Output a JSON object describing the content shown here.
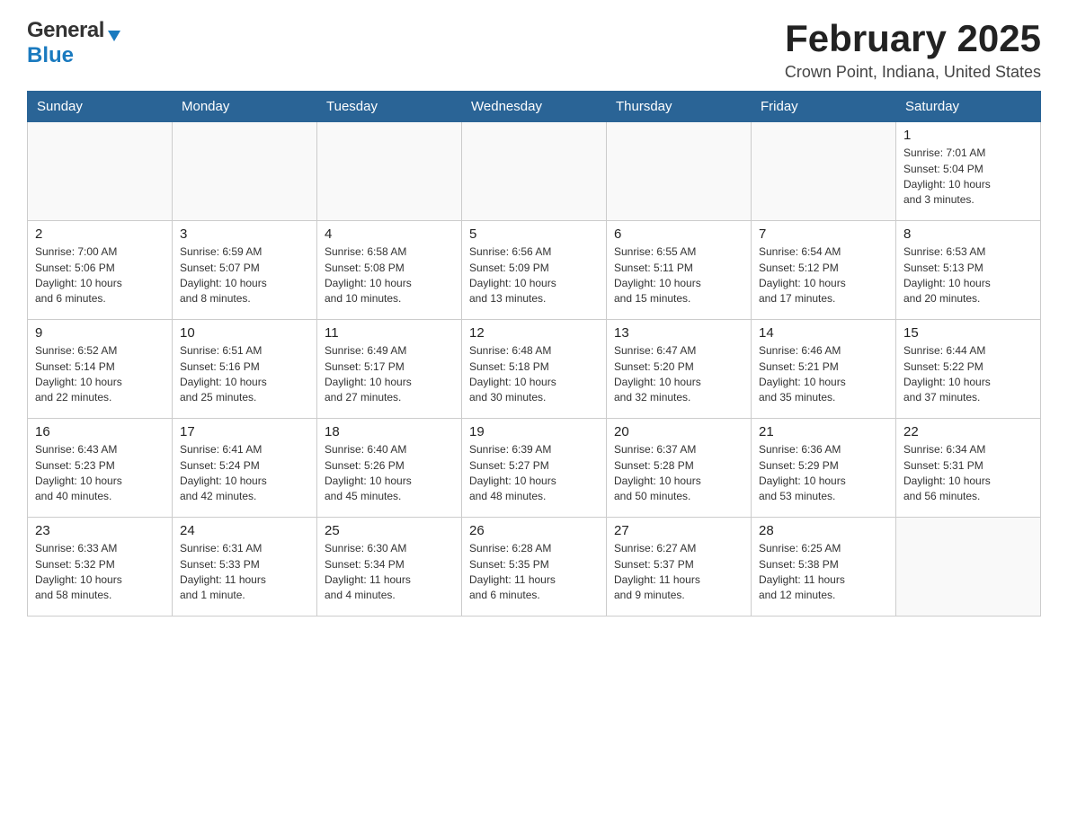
{
  "header": {
    "logo_general": "General",
    "logo_blue": "Blue",
    "month_title": "February 2025",
    "location": "Crown Point, Indiana, United States"
  },
  "days_of_week": [
    "Sunday",
    "Monday",
    "Tuesday",
    "Wednesday",
    "Thursday",
    "Friday",
    "Saturday"
  ],
  "weeks": [
    [
      {
        "day": "",
        "info": ""
      },
      {
        "day": "",
        "info": ""
      },
      {
        "day": "",
        "info": ""
      },
      {
        "day": "",
        "info": ""
      },
      {
        "day": "",
        "info": ""
      },
      {
        "day": "",
        "info": ""
      },
      {
        "day": "1",
        "info": "Sunrise: 7:01 AM\nSunset: 5:04 PM\nDaylight: 10 hours\nand 3 minutes."
      }
    ],
    [
      {
        "day": "2",
        "info": "Sunrise: 7:00 AM\nSunset: 5:06 PM\nDaylight: 10 hours\nand 6 minutes."
      },
      {
        "day": "3",
        "info": "Sunrise: 6:59 AM\nSunset: 5:07 PM\nDaylight: 10 hours\nand 8 minutes."
      },
      {
        "day": "4",
        "info": "Sunrise: 6:58 AM\nSunset: 5:08 PM\nDaylight: 10 hours\nand 10 minutes."
      },
      {
        "day": "5",
        "info": "Sunrise: 6:56 AM\nSunset: 5:09 PM\nDaylight: 10 hours\nand 13 minutes."
      },
      {
        "day": "6",
        "info": "Sunrise: 6:55 AM\nSunset: 5:11 PM\nDaylight: 10 hours\nand 15 minutes."
      },
      {
        "day": "7",
        "info": "Sunrise: 6:54 AM\nSunset: 5:12 PM\nDaylight: 10 hours\nand 17 minutes."
      },
      {
        "day": "8",
        "info": "Sunrise: 6:53 AM\nSunset: 5:13 PM\nDaylight: 10 hours\nand 20 minutes."
      }
    ],
    [
      {
        "day": "9",
        "info": "Sunrise: 6:52 AM\nSunset: 5:14 PM\nDaylight: 10 hours\nand 22 minutes."
      },
      {
        "day": "10",
        "info": "Sunrise: 6:51 AM\nSunset: 5:16 PM\nDaylight: 10 hours\nand 25 minutes."
      },
      {
        "day": "11",
        "info": "Sunrise: 6:49 AM\nSunset: 5:17 PM\nDaylight: 10 hours\nand 27 minutes."
      },
      {
        "day": "12",
        "info": "Sunrise: 6:48 AM\nSunset: 5:18 PM\nDaylight: 10 hours\nand 30 minutes."
      },
      {
        "day": "13",
        "info": "Sunrise: 6:47 AM\nSunset: 5:20 PM\nDaylight: 10 hours\nand 32 minutes."
      },
      {
        "day": "14",
        "info": "Sunrise: 6:46 AM\nSunset: 5:21 PM\nDaylight: 10 hours\nand 35 minutes."
      },
      {
        "day": "15",
        "info": "Sunrise: 6:44 AM\nSunset: 5:22 PM\nDaylight: 10 hours\nand 37 minutes."
      }
    ],
    [
      {
        "day": "16",
        "info": "Sunrise: 6:43 AM\nSunset: 5:23 PM\nDaylight: 10 hours\nand 40 minutes."
      },
      {
        "day": "17",
        "info": "Sunrise: 6:41 AM\nSunset: 5:24 PM\nDaylight: 10 hours\nand 42 minutes."
      },
      {
        "day": "18",
        "info": "Sunrise: 6:40 AM\nSunset: 5:26 PM\nDaylight: 10 hours\nand 45 minutes."
      },
      {
        "day": "19",
        "info": "Sunrise: 6:39 AM\nSunset: 5:27 PM\nDaylight: 10 hours\nand 48 minutes."
      },
      {
        "day": "20",
        "info": "Sunrise: 6:37 AM\nSunset: 5:28 PM\nDaylight: 10 hours\nand 50 minutes."
      },
      {
        "day": "21",
        "info": "Sunrise: 6:36 AM\nSunset: 5:29 PM\nDaylight: 10 hours\nand 53 minutes."
      },
      {
        "day": "22",
        "info": "Sunrise: 6:34 AM\nSunset: 5:31 PM\nDaylight: 10 hours\nand 56 minutes."
      }
    ],
    [
      {
        "day": "23",
        "info": "Sunrise: 6:33 AM\nSunset: 5:32 PM\nDaylight: 10 hours\nand 58 minutes."
      },
      {
        "day": "24",
        "info": "Sunrise: 6:31 AM\nSunset: 5:33 PM\nDaylight: 11 hours\nand 1 minute."
      },
      {
        "day": "25",
        "info": "Sunrise: 6:30 AM\nSunset: 5:34 PM\nDaylight: 11 hours\nand 4 minutes."
      },
      {
        "day": "26",
        "info": "Sunrise: 6:28 AM\nSunset: 5:35 PM\nDaylight: 11 hours\nand 6 minutes."
      },
      {
        "day": "27",
        "info": "Sunrise: 6:27 AM\nSunset: 5:37 PM\nDaylight: 11 hours\nand 9 minutes."
      },
      {
        "day": "28",
        "info": "Sunrise: 6:25 AM\nSunset: 5:38 PM\nDaylight: 11 hours\nand 12 minutes."
      },
      {
        "day": "",
        "info": ""
      }
    ]
  ]
}
